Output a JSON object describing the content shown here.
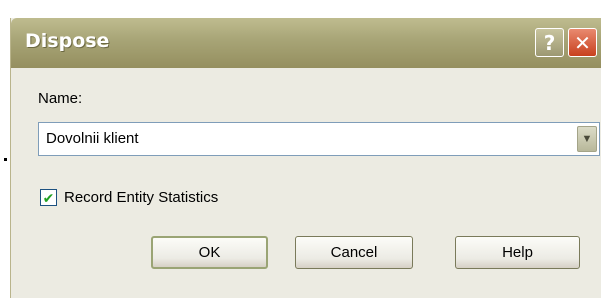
{
  "window": {
    "title": "Dispose",
    "help_glyph": "?",
    "close_glyph": "✕"
  },
  "form": {
    "name_label": "Name:",
    "name_value": "Dovolnii klient",
    "dropdown_glyph": "▼",
    "record_stats_label": "Record Entity Statistics",
    "record_stats_checked": true,
    "check_glyph": "✔"
  },
  "buttons": {
    "ok": "OK",
    "cancel": "Cancel",
    "help": "Help"
  },
  "colors": {
    "titlebar": "#a7a476",
    "close_button": "#c8401e",
    "dialog_background": "#ecebe2",
    "checkmark": "#21a121"
  }
}
